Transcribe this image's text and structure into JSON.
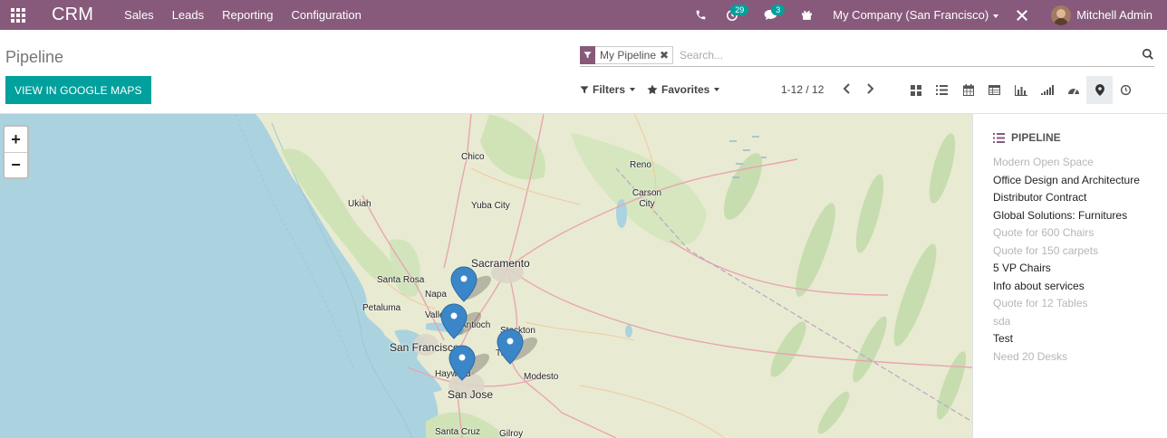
{
  "nav": {
    "brand": "CRM",
    "menu": [
      "Sales",
      "Leads",
      "Reporting",
      "Configuration"
    ],
    "activity_count": "29",
    "message_count": "3",
    "company": "My Company (San Francisco)",
    "user": "Mitchell Admin"
  },
  "control": {
    "title": "Pipeline",
    "google_maps_button": "VIEW IN GOOGLE MAPS",
    "facet_label": "My Pipeline",
    "search_placeholder": "Search...",
    "filters_label": "Filters",
    "favorites_label": "Favorites",
    "pager": "1-12 / 12"
  },
  "map": {
    "cities": [
      "Chico",
      "Reno",
      "Carson City",
      "Yuba City",
      "Ukiah",
      "Sacramento",
      "Santa Rosa",
      "Napa",
      "Petaluma",
      "Vallejo",
      "Antioch",
      "Stockton",
      "San Francisco",
      "Hayward",
      "Tracy",
      "San Jose",
      "Modesto",
      "Santa Cruz",
      "Gilroy"
    ]
  },
  "sidebar": {
    "header": "PIPELINE",
    "records": [
      {
        "name": "Modern Open Space",
        "located": false
      },
      {
        "name": "Office Design and Architecture",
        "located": true
      },
      {
        "name": "Distributor Contract",
        "located": true
      },
      {
        "name": "Global Solutions: Furnitures",
        "located": true
      },
      {
        "name": "Quote for 600 Chairs",
        "located": false
      },
      {
        "name": "Quote for 150 carpets",
        "located": false
      },
      {
        "name": "5 VP Chairs",
        "located": true
      },
      {
        "name": "Info about services",
        "located": true
      },
      {
        "name": "Quote for 12 Tables",
        "located": false
      },
      {
        "name": "sda",
        "located": false
      },
      {
        "name": "Test",
        "located": true
      },
      {
        "name": "Need 20 Desks",
        "located": false
      }
    ]
  },
  "colors": {
    "brand": "#875a7b",
    "accent": "#00a09d",
    "marker": "#3a86c8",
    "water": "#aad3df",
    "land": "#e9ead2"
  }
}
